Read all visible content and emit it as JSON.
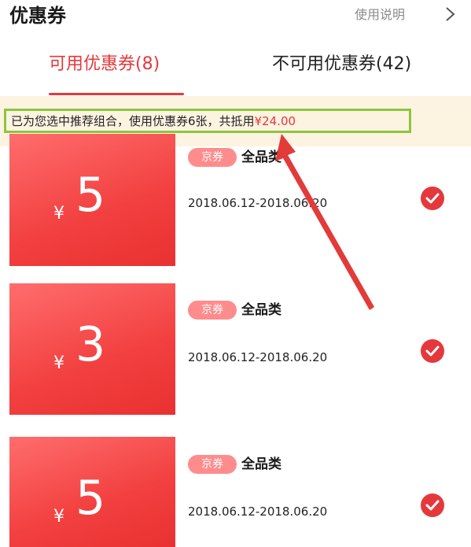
{
  "header": {
    "title": "优惠券",
    "help_label": "使用说明"
  },
  "tabs": [
    {
      "label": "可用优惠券(8)",
      "active": true
    },
    {
      "label": "不可用优惠券(42)",
      "active": false
    }
  ],
  "notice": {
    "text": "已为您选中推荐组合，使用优惠券6张，共抵用",
    "amount": "¥24.00"
  },
  "coupons": [
    {
      "currency": "¥",
      "amount": "5",
      "badge": "京券",
      "scope": "全品类",
      "validity": "2018.06.12-2018.06.20",
      "selected": true
    },
    {
      "currency": "¥",
      "amount": "3",
      "badge": "京券",
      "scope": "全品类",
      "validity": "2018.06.12-2018.06.20",
      "selected": true
    },
    {
      "currency": "¥",
      "amount": "5",
      "badge": "京券",
      "scope": "全品类",
      "validity": "2018.06.12-2018.06.20",
      "selected": true
    }
  ],
  "colors": {
    "accent": "#e4393c",
    "highlight_border": "#8bc63f",
    "notice_bg": "#fdf3e1"
  },
  "icons": {
    "close": "close-icon",
    "check": "check-icon",
    "annotation": "annotation-arrow"
  }
}
